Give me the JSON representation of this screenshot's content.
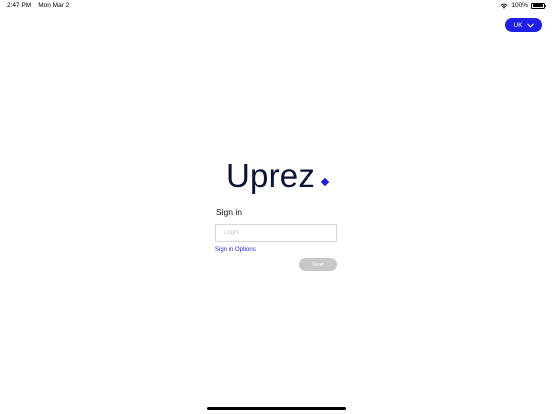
{
  "status_bar": {
    "time": "2:47 PM",
    "date": "Mon Mar 2",
    "battery": "100%",
    "icons": [
      "wifi-icon",
      "battery-icon"
    ]
  },
  "region_selector": {
    "label": "UK",
    "icon": "chevron-down-icon"
  },
  "brand": {
    "name": "Uprez",
    "primary_color": "#1f1fe5",
    "text_color": "#0a1236"
  },
  "signin": {
    "title": "Sign in",
    "login_placeholder": "Login",
    "login_value": "",
    "options_link": "Sign in Options",
    "next_label": "Next",
    "next_disabled_color": "#c7c7c7"
  }
}
